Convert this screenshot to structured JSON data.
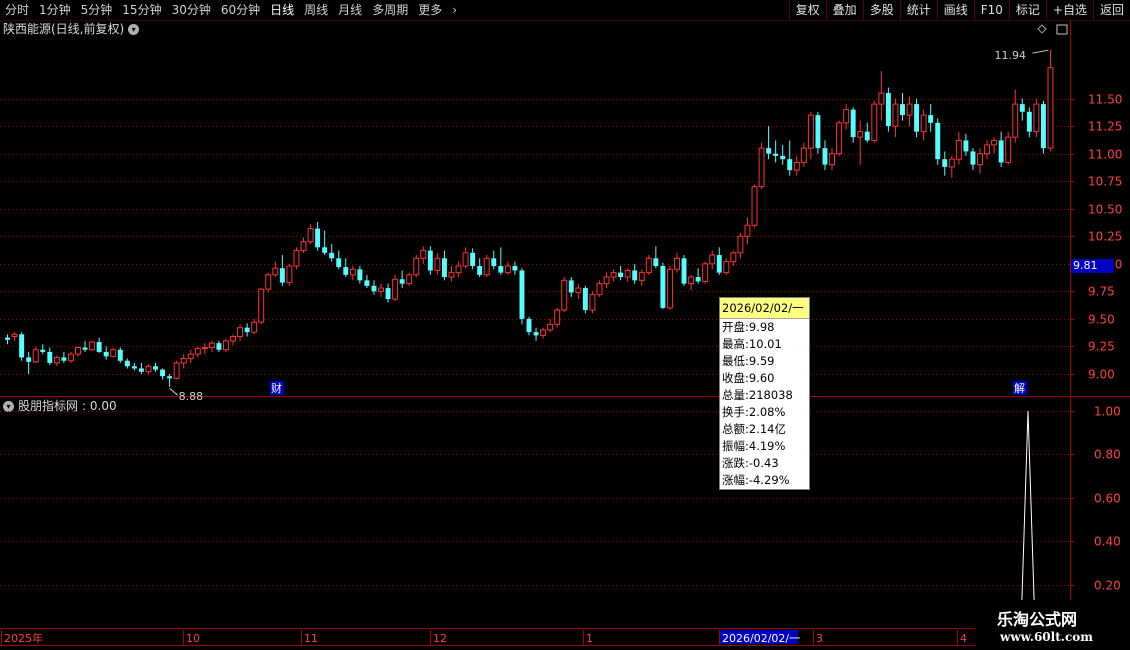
{
  "toolbar": {
    "timeframes": [
      "分时",
      "1分钟",
      "5分钟",
      "15分钟",
      "30分钟",
      "60分钟",
      "日线",
      "周线",
      "月线",
      "多周期",
      "更多"
    ],
    "active": "日线",
    "more_icon": "chevron-right-icon",
    "tools": [
      "复权",
      "叠加",
      "多股",
      "统计",
      "画线",
      "F10",
      "标记",
      "+自选",
      "返回"
    ]
  },
  "chart": {
    "title": "陕西能源(日线,前复权)",
    "high_label": "11.94",
    "low_label": "8.88",
    "current_price": "9.81",
    "marker_cai": "财",
    "marker_jie": "解",
    "price_ticks": [
      "11.50",
      "11.25",
      "11.00",
      "10.75",
      "10.50",
      "10.25",
      "10.00",
      "9.75",
      "9.50",
      "9.25",
      "9.00"
    ],
    "up_color": "#ff3232",
    "down_color": "#54ffff"
  },
  "indicator": {
    "title": "股朋指标网",
    "value": ": 0.00",
    "ticks": [
      "1.00",
      "0.80",
      "0.60",
      "0.40",
      "0.20"
    ]
  },
  "tooltip": {
    "date": "2026/02/02/一",
    "rows": [
      "开盘:9.98",
      "最高:10.01",
      "最低:9.59",
      "收盘:9.60",
      "总量:218038",
      "换手:2.08%",
      "总额:2.14亿",
      "振幅:4.19%",
      "涨跌:-0.43",
      "涨幅:-4.29%"
    ]
  },
  "date_axis": {
    "labels": [
      "2025年",
      "10",
      "11",
      "12",
      "1",
      "2026/02/02/一",
      "3",
      "4"
    ]
  },
  "watermark": {
    "line1": "乐淘公式网",
    "line2": "www.60lt.com"
  },
  "chart_data": {
    "type": "candlestick",
    "price_range": [
      8.8,
      12.05
    ],
    "candles": [
      {
        "o": 9.33,
        "h": 9.36,
        "l": 9.27,
        "c": 9.31
      },
      {
        "o": 9.34,
        "h": 9.38,
        "l": 9.3,
        "c": 9.36
      },
      {
        "o": 9.36,
        "h": 9.38,
        "l": 9.12,
        "c": 9.15
      },
      {
        "o": 9.15,
        "h": 9.2,
        "l": 9.0,
        "c": 9.11
      },
      {
        "o": 9.11,
        "h": 9.25,
        "l": 9.1,
        "c": 9.22
      },
      {
        "o": 9.22,
        "h": 9.27,
        "l": 9.18,
        "c": 9.2
      },
      {
        "o": 9.2,
        "h": 9.24,
        "l": 9.08,
        "c": 9.1
      },
      {
        "o": 9.1,
        "h": 9.17,
        "l": 9.07,
        "c": 9.15
      },
      {
        "o": 9.15,
        "h": 9.2,
        "l": 9.1,
        "c": 9.12
      },
      {
        "o": 9.12,
        "h": 9.2,
        "l": 9.1,
        "c": 9.18
      },
      {
        "o": 9.18,
        "h": 9.25,
        "l": 9.16,
        "c": 9.24
      },
      {
        "o": 9.24,
        "h": 9.3,
        "l": 9.2,
        "c": 9.22
      },
      {
        "o": 9.22,
        "h": 9.3,
        "l": 9.21,
        "c": 9.29
      },
      {
        "o": 9.29,
        "h": 9.33,
        "l": 9.19,
        "c": 9.2
      },
      {
        "o": 9.2,
        "h": 9.25,
        "l": 9.13,
        "c": 9.16
      },
      {
        "o": 9.16,
        "h": 9.24,
        "l": 9.15,
        "c": 9.22
      },
      {
        "o": 9.22,
        "h": 9.24,
        "l": 9.1,
        "c": 9.12
      },
      {
        "o": 9.12,
        "h": 9.14,
        "l": 9.05,
        "c": 9.07
      },
      {
        "o": 9.07,
        "h": 9.1,
        "l": 9.03,
        "c": 9.05
      },
      {
        "o": 9.05,
        "h": 9.1,
        "l": 9.0,
        "c": 9.02
      },
      {
        "o": 9.02,
        "h": 9.09,
        "l": 9.0,
        "c": 9.07
      },
      {
        "o": 9.07,
        "h": 9.1,
        "l": 9.02,
        "c": 9.04
      },
      {
        "o": 9.04,
        "h": 9.05,
        "l": 8.95,
        "c": 8.98
      },
      {
        "o": 8.98,
        "h": 9.0,
        "l": 8.88,
        "c": 8.96
      },
      {
        "o": 8.96,
        "h": 9.12,
        "l": 8.95,
        "c": 9.1
      },
      {
        "o": 9.1,
        "h": 9.18,
        "l": 9.05,
        "c": 9.14
      },
      {
        "o": 9.14,
        "h": 9.22,
        "l": 9.1,
        "c": 9.18
      },
      {
        "o": 9.18,
        "h": 9.25,
        "l": 9.15,
        "c": 9.23
      },
      {
        "o": 9.23,
        "h": 9.28,
        "l": 9.18,
        "c": 9.24
      },
      {
        "o": 9.24,
        "h": 9.3,
        "l": 9.2,
        "c": 9.28
      },
      {
        "o": 9.28,
        "h": 9.3,
        "l": 9.2,
        "c": 9.22
      },
      {
        "o": 9.22,
        "h": 9.32,
        "l": 9.2,
        "c": 9.3
      },
      {
        "o": 9.3,
        "h": 9.36,
        "l": 9.26,
        "c": 9.34
      },
      {
        "o": 9.34,
        "h": 9.45,
        "l": 9.3,
        "c": 9.42
      },
      {
        "o": 9.42,
        "h": 9.46,
        "l": 9.34,
        "c": 9.38
      },
      {
        "o": 9.38,
        "h": 9.5,
        "l": 9.36,
        "c": 9.47
      },
      {
        "o": 9.47,
        "h": 9.78,
        "l": 9.45,
        "c": 9.77
      },
      {
        "o": 9.77,
        "h": 9.92,
        "l": 9.74,
        "c": 9.9
      },
      {
        "o": 9.9,
        "h": 10.02,
        "l": 9.88,
        "c": 9.96
      },
      {
        "o": 9.96,
        "h": 10.08,
        "l": 9.8,
        "c": 9.83
      },
      {
        "o": 9.83,
        "h": 10.0,
        "l": 9.8,
        "c": 9.98
      },
      {
        "o": 9.98,
        "h": 10.15,
        "l": 9.95,
        "c": 10.12
      },
      {
        "o": 10.12,
        "h": 10.24,
        "l": 10.1,
        "c": 10.2
      },
      {
        "o": 10.2,
        "h": 10.36,
        "l": 10.18,
        "c": 10.32
      },
      {
        "o": 10.32,
        "h": 10.38,
        "l": 10.12,
        "c": 10.15
      },
      {
        "o": 10.15,
        "h": 10.3,
        "l": 10.08,
        "c": 10.1
      },
      {
        "o": 10.1,
        "h": 10.18,
        "l": 10.02,
        "c": 10.05
      },
      {
        "o": 10.05,
        "h": 10.12,
        "l": 9.95,
        "c": 9.97
      },
      {
        "o": 9.97,
        "h": 10.05,
        "l": 9.88,
        "c": 9.9
      },
      {
        "o": 9.9,
        "h": 9.98,
        "l": 9.85,
        "c": 9.95
      },
      {
        "o": 9.95,
        "h": 9.98,
        "l": 9.82,
        "c": 9.85
      },
      {
        "o": 9.85,
        "h": 9.9,
        "l": 9.78,
        "c": 9.8
      },
      {
        "o": 9.8,
        "h": 9.85,
        "l": 9.72,
        "c": 9.75
      },
      {
        "o": 9.75,
        "h": 9.82,
        "l": 9.7,
        "c": 9.78
      },
      {
        "o": 9.78,
        "h": 9.82,
        "l": 9.65,
        "c": 9.68
      },
      {
        "o": 9.68,
        "h": 9.9,
        "l": 9.66,
        "c": 9.86
      },
      {
        "o": 9.86,
        "h": 9.94,
        "l": 9.78,
        "c": 9.82
      },
      {
        "o": 9.82,
        "h": 9.92,
        "l": 9.8,
        "c": 9.9
      },
      {
        "o": 9.9,
        "h": 10.08,
        "l": 9.88,
        "c": 10.05
      },
      {
        "o": 10.05,
        "h": 10.16,
        "l": 10.0,
        "c": 10.12
      },
      {
        "o": 10.12,
        "h": 10.16,
        "l": 9.9,
        "c": 9.94
      },
      {
        "o": 9.94,
        "h": 10.1,
        "l": 9.9,
        "c": 10.05
      },
      {
        "o": 10.05,
        "h": 10.12,
        "l": 9.85,
        "c": 9.88
      },
      {
        "o": 9.88,
        "h": 9.98,
        "l": 9.84,
        "c": 9.92
      },
      {
        "o": 9.92,
        "h": 10.02,
        "l": 9.88,
        "c": 9.98
      },
      {
        "o": 9.98,
        "h": 10.15,
        "l": 9.96,
        "c": 10.1
      },
      {
        "o": 10.1,
        "h": 10.14,
        "l": 9.95,
        "c": 9.98
      },
      {
        "o": 9.98,
        "h": 10.05,
        "l": 9.88,
        "c": 9.9
      },
      {
        "o": 9.9,
        "h": 10.08,
        "l": 9.88,
        "c": 10.05
      },
      {
        "o": 10.05,
        "h": 10.12,
        "l": 9.95,
        "c": 9.98
      },
      {
        "o": 9.98,
        "h": 10.15,
        "l": 9.9,
        "c": 9.92
      },
      {
        "o": 9.92,
        "h": 10.02,
        "l": 9.9,
        "c": 9.98
      },
      {
        "o": 9.98,
        "h": 10.02,
        "l": 9.9,
        "c": 9.94
      },
      {
        "o": 9.94,
        "h": 9.96,
        "l": 9.45,
        "c": 9.5
      },
      {
        "o": 9.5,
        "h": 9.52,
        "l": 9.35,
        "c": 9.38
      },
      {
        "o": 9.38,
        "h": 9.42,
        "l": 9.3,
        "c": 9.35
      },
      {
        "o": 9.35,
        "h": 9.42,
        "l": 9.32,
        "c": 9.4
      },
      {
        "o": 9.4,
        "h": 9.5,
        "l": 9.38,
        "c": 9.45
      },
      {
        "o": 9.45,
        "h": 9.6,
        "l": 9.42,
        "c": 9.58
      },
      {
        "o": 9.58,
        "h": 9.88,
        "l": 9.56,
        "c": 9.85
      },
      {
        "o": 9.85,
        "h": 9.88,
        "l": 9.7,
        "c": 9.74
      },
      {
        "o": 9.74,
        "h": 9.82,
        "l": 9.68,
        "c": 9.78
      },
      {
        "o": 9.78,
        "h": 9.8,
        "l": 9.55,
        "c": 9.58
      },
      {
        "o": 9.58,
        "h": 9.75,
        "l": 9.55,
        "c": 9.72
      },
      {
        "o": 9.72,
        "h": 9.85,
        "l": 9.7,
        "c": 9.82
      },
      {
        "o": 9.82,
        "h": 9.92,
        "l": 9.78,
        "c": 9.88
      },
      {
        "o": 9.88,
        "h": 9.95,
        "l": 9.84,
        "c": 9.92
      },
      {
        "o": 9.92,
        "h": 9.98,
        "l": 9.85,
        "c": 9.88
      },
      {
        "o": 9.88,
        "h": 9.96,
        "l": 9.84,
        "c": 9.94
      },
      {
        "o": 9.94,
        "h": 10.0,
        "l": 9.82,
        "c": 9.85
      },
      {
        "o": 9.85,
        "h": 9.95,
        "l": 9.8,
        "c": 9.92
      },
      {
        "o": 9.92,
        "h": 10.08,
        "l": 9.9,
        "c": 10.05
      },
      {
        "o": 10.05,
        "h": 10.16,
        "l": 9.96,
        "c": 9.98
      },
      {
        "o": 9.98,
        "h": 10.01,
        "l": 9.59,
        "c": 9.6
      },
      {
        "o": 9.6,
        "h": 9.98,
        "l": 9.58,
        "c": 9.95
      },
      {
        "o": 9.95,
        "h": 10.1,
        "l": 9.92,
        "c": 10.05
      },
      {
        "o": 10.05,
        "h": 10.08,
        "l": 9.8,
        "c": 9.82
      },
      {
        "o": 9.82,
        "h": 9.9,
        "l": 9.76,
        "c": 9.88
      },
      {
        "o": 9.88,
        "h": 9.96,
        "l": 9.82,
        "c": 9.84
      },
      {
        "o": 9.84,
        "h": 10.02,
        "l": 9.82,
        "c": 10.0
      },
      {
        "o": 10.0,
        "h": 10.12,
        "l": 9.95,
        "c": 10.08
      },
      {
        "o": 10.08,
        "h": 10.15,
        "l": 9.9,
        "c": 9.92
      },
      {
        "o": 9.92,
        "h": 10.05,
        "l": 9.9,
        "c": 10.02
      },
      {
        "o": 10.02,
        "h": 10.12,
        "l": 9.98,
        "c": 10.1
      },
      {
        "o": 10.1,
        "h": 10.28,
        "l": 10.05,
        "c": 10.25
      },
      {
        "o": 10.25,
        "h": 10.42,
        "l": 10.18,
        "c": 10.35
      },
      {
        "o": 10.35,
        "h": 10.72,
        "l": 10.33,
        "c": 10.7
      },
      {
        "o": 10.7,
        "h": 11.1,
        "l": 10.68,
        "c": 11.05
      },
      {
        "o": 11.05,
        "h": 11.25,
        "l": 10.95,
        "c": 11.0
      },
      {
        "o": 11.0,
        "h": 11.12,
        "l": 10.92,
        "c": 10.98
      },
      {
        "o": 10.98,
        "h": 11.08,
        "l": 10.9,
        "c": 10.95
      },
      {
        "o": 10.95,
        "h": 11.12,
        "l": 10.8,
        "c": 10.85
      },
      {
        "o": 10.85,
        "h": 10.98,
        "l": 10.8,
        "c": 10.92
      },
      {
        "o": 10.92,
        "h": 11.1,
        "l": 10.88,
        "c": 11.05
      },
      {
        "o": 11.05,
        "h": 11.38,
        "l": 10.95,
        "c": 11.35
      },
      {
        "o": 11.35,
        "h": 11.38,
        "l": 11.0,
        "c": 11.05
      },
      {
        "o": 11.05,
        "h": 11.12,
        "l": 10.85,
        "c": 10.9
      },
      {
        "o": 10.9,
        "h": 11.05,
        "l": 10.85,
        "c": 11.0
      },
      {
        "o": 11.0,
        "h": 11.3,
        "l": 10.98,
        "c": 11.28
      },
      {
        "o": 11.28,
        "h": 11.45,
        "l": 11.22,
        "c": 11.4
      },
      {
        "o": 11.4,
        "h": 11.42,
        "l": 11.1,
        "c": 11.15
      },
      {
        "o": 11.15,
        "h": 11.3,
        "l": 10.9,
        "c": 11.2
      },
      {
        "o": 11.2,
        "h": 11.28,
        "l": 11.1,
        "c": 11.12
      },
      {
        "o": 11.12,
        "h": 11.48,
        "l": 11.1,
        "c": 11.45
      },
      {
        "o": 11.45,
        "h": 11.75,
        "l": 11.3,
        "c": 11.55
      },
      {
        "o": 11.55,
        "h": 11.6,
        "l": 11.2,
        "c": 11.25
      },
      {
        "o": 11.25,
        "h": 11.5,
        "l": 11.15,
        "c": 11.45
      },
      {
        "o": 11.45,
        "h": 11.55,
        "l": 11.3,
        "c": 11.35
      },
      {
        "o": 11.35,
        "h": 11.52,
        "l": 11.25,
        "c": 11.45
      },
      {
        "o": 11.45,
        "h": 11.5,
        "l": 11.15,
        "c": 11.2
      },
      {
        "o": 11.2,
        "h": 11.4,
        "l": 11.12,
        "c": 11.35
      },
      {
        "o": 11.35,
        "h": 11.45,
        "l": 11.2,
        "c": 11.28
      },
      {
        "o": 11.28,
        "h": 11.32,
        "l": 10.9,
        "c": 10.95
      },
      {
        "o": 10.95,
        "h": 11.02,
        "l": 10.8,
        "c": 10.88
      },
      {
        "o": 10.88,
        "h": 10.98,
        "l": 10.78,
        "c": 10.95
      },
      {
        "o": 10.95,
        "h": 11.2,
        "l": 10.9,
        "c": 11.12
      },
      {
        "o": 11.12,
        "h": 11.18,
        "l": 10.98,
        "c": 11.02
      },
      {
        "o": 11.02,
        "h": 11.05,
        "l": 10.85,
        "c": 10.9
      },
      {
        "o": 10.9,
        "h": 11.05,
        "l": 10.82,
        "c": 11.0
      },
      {
        "o": 11.0,
        "h": 11.12,
        "l": 10.95,
        "c": 11.08
      },
      {
        "o": 11.08,
        "h": 11.15,
        "l": 11.0,
        "c": 11.12
      },
      {
        "o": 11.12,
        "h": 11.2,
        "l": 10.88,
        "c": 10.92
      },
      {
        "o": 10.92,
        "h": 11.2,
        "l": 10.9,
        "c": 11.15
      },
      {
        "o": 11.15,
        "h": 11.58,
        "l": 11.1,
        "c": 11.45
      },
      {
        "o": 11.45,
        "h": 11.5,
        "l": 11.3,
        "c": 11.38
      },
      {
        "o": 11.38,
        "h": 11.42,
        "l": 11.15,
        "c": 11.2
      },
      {
        "o": 11.2,
        "h": 11.5,
        "l": 11.15,
        "c": 11.45
      },
      {
        "o": 11.45,
        "h": 11.48,
        "l": 11.0,
        "c": 11.05
      },
      {
        "o": 11.05,
        "h": 11.94,
        "l": 11.02,
        "c": 11.78
      }
    ],
    "indicator_peak": 1.0,
    "indicator_range": [
      0,
      1.05
    ]
  }
}
